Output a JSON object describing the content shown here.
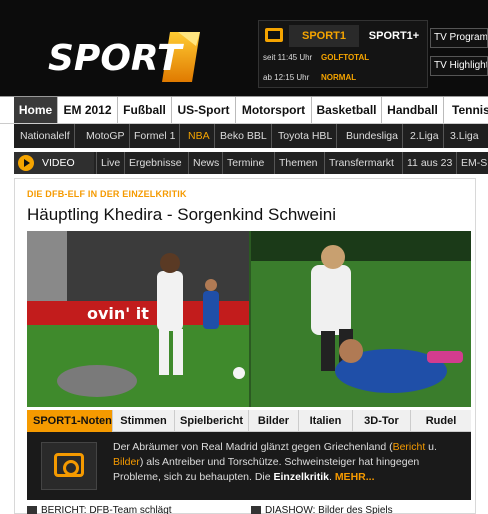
{
  "header": {
    "logo_text": "SPORT1",
    "tv": {
      "channels": [
        "SPORT1",
        "SPORT1+"
      ],
      "schedule": [
        {
          "time": "seit 11:45 Uhr",
          "program": "GOLFTOTAL"
        },
        {
          "time": "ab 12:15 Uhr",
          "program": "NORMAL"
        }
      ],
      "buttons": [
        "TV Programm",
        "TV Highlights"
      ]
    }
  },
  "main_nav": [
    "Home",
    "EM 2012",
    "Fußball",
    "US-Sport",
    "Motorsport",
    "Basketball",
    "Handball",
    "Tennis"
  ],
  "sub_nav": [
    "Nationalelf",
    "MotoGP",
    "Formel 1",
    "NBA",
    "Beko BBL",
    "Toyota HBL",
    "Bundesliga",
    "2.Liga",
    "3.Liga"
  ],
  "video_bar": {
    "label": "VIDEO",
    "items": [
      "Live",
      "Ergebnisse",
      "News",
      "Termine",
      "Themen",
      "Transfermarkt",
      "11 aus 23",
      "EM-S"
    ]
  },
  "article": {
    "kicker": "DIE DFB-ELF IN DER EINZELKRITIK",
    "headline": "Häuptling Khedira - Sorgenkind Schweini",
    "photo_tabs": [
      "SPORT1-Noten",
      "Stimmen",
      "Spielbericht",
      "Bilder",
      "Italien",
      "3D-Tor",
      "Rudel"
    ],
    "teaser": {
      "t1": "Der Abräumer von Real Madrid glänzt gegen Griechenland (",
      "link1": "Bericht",
      "t2": " u. ",
      "link2": "Bilder",
      "t3": ") als Antreiber und Torschütze. Schweinsteiger hat hingegen Probleme, sich zu behaupten. Die ",
      "bold": "Einzelkritik",
      "t4": ". ",
      "more": "MEHR..."
    },
    "bottom_links": [
      "BERICHT: DFB-Team schlägt",
      "DIASHOW: Bilder des Spiels"
    ]
  },
  "colors": {
    "accent": "#f59a00",
    "header_bg": "#0c0c0c",
    "nav_dark": "#1f1f1f"
  }
}
